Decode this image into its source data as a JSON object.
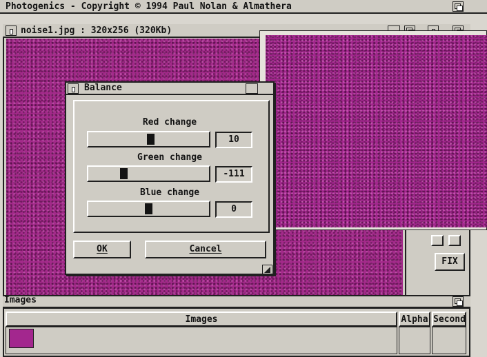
{
  "screen": {
    "title": "Photogenics - Copyright © 1994 Paul Nolan & Almathera"
  },
  "image_window": {
    "title": "noise1.jpg : 320x256 (320Kb)",
    "fix_label": "FIX"
  },
  "balance_dialog": {
    "title": "Balance",
    "sliders": [
      {
        "label": "Red change",
        "value": "10",
        "level": 0.52
      },
      {
        "label": "Green change",
        "value": "-111",
        "level": 0.28
      },
      {
        "label": "Blue change",
        "value": "0",
        "level": 0.5
      }
    ],
    "ok_label": "OK",
    "cancel_label": "Cancel"
  },
  "images_panel": {
    "title": "Images",
    "columns": [
      "Images",
      "Alpha",
      "Second"
    ]
  },
  "colors": {
    "image_magenta": "#a3278e",
    "ui_grey": "#cfccc4"
  }
}
